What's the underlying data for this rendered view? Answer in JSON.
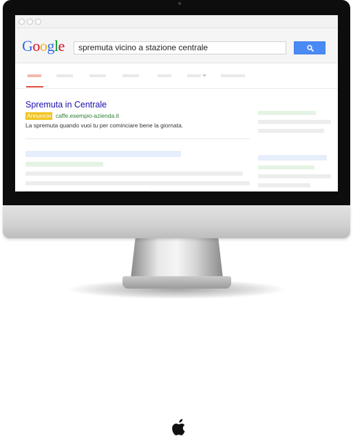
{
  "browser": {
    "search_query": "spremuta vicino a stazione centrale",
    "search_icon": "search-icon"
  },
  "google_logo": {
    "letters": [
      "G",
      "o",
      "o",
      "g",
      "l",
      "e"
    ],
    "colors": [
      "#3369e8",
      "#d50f25",
      "#eeb211",
      "#3369e8",
      "#009925",
      "#d50f25"
    ]
  },
  "ad": {
    "title": "Spremuta in Centrale",
    "badge": "Annuncio",
    "url": "caffe.esempio-azienda.it",
    "description": "La spremuta quando vuoi tu per cominciare bene la giornata."
  },
  "colors": {
    "accent_blue": "#4a8af4",
    "link": "#1a0dab",
    "url_green": "#2e7d32",
    "ad_badge": "#f0c420",
    "active_tab": "#dd4b39"
  },
  "device": {
    "logo_icon": "apple-logo-icon"
  }
}
